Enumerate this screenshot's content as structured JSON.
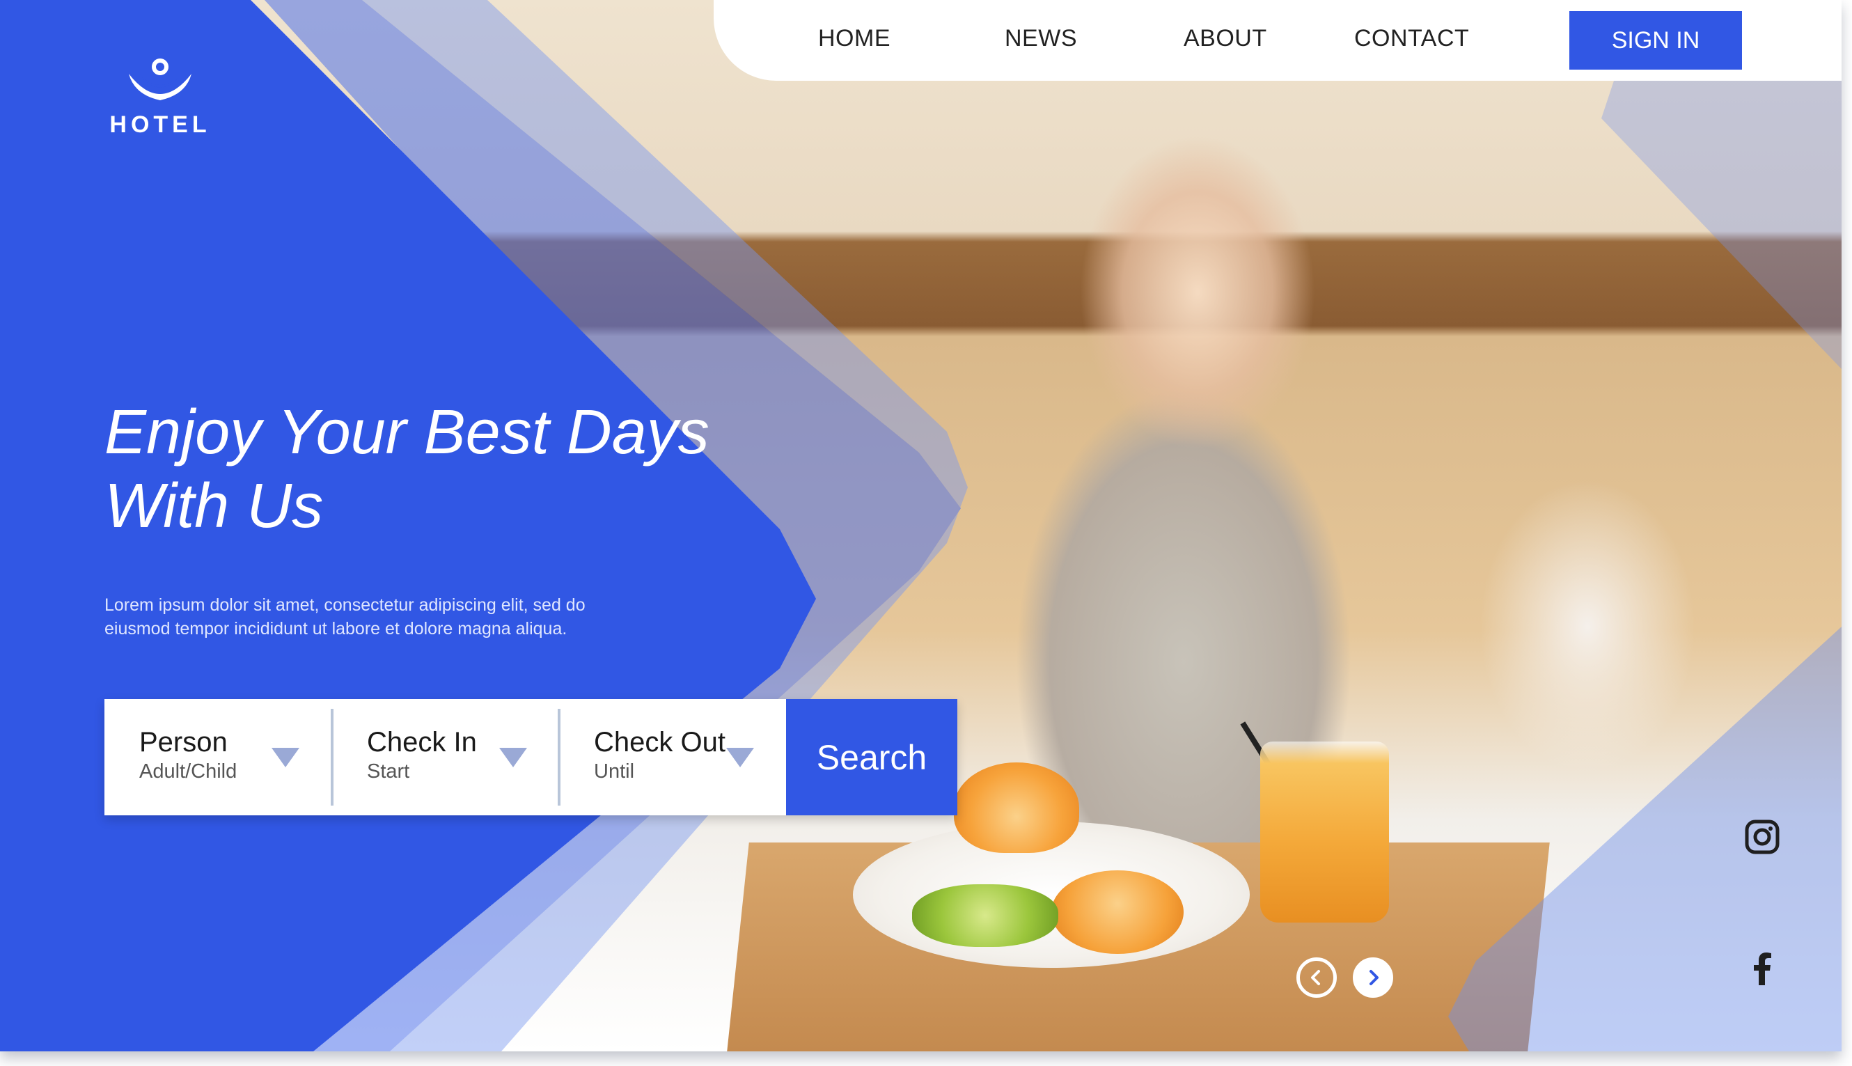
{
  "brand": {
    "name": "HOTEL",
    "color_primary": "#3157e4"
  },
  "nav": {
    "links": [
      "HOME",
      "NEWS",
      "ABOUT",
      "CONTACT"
    ],
    "sign_in": "SIGN IN"
  },
  "hero": {
    "headline_line1": "Enjoy Your Best Days",
    "headline_line2": "With Us",
    "description_line1": "Lorem ipsum dolor sit amet, consectetur adipiscing elit, sed do",
    "description_line2": "eiusmod tempor incididunt ut labore et dolore magna aliqua."
  },
  "booking": {
    "fields": [
      {
        "label": "Person",
        "sub": "Adult/Child",
        "icon": "chevron-down-icon"
      },
      {
        "label": "Check In",
        "sub": "Start",
        "icon": "chevron-down-icon"
      },
      {
        "label": "Check Out",
        "sub": "Until",
        "icon": "chevron-down-icon"
      }
    ],
    "search_label": "Search"
  },
  "carousel": {
    "prev_icon": "arrow-left-icon",
    "next_icon": "arrow-right-icon"
  },
  "social": {
    "icons": [
      "instagram-icon",
      "facebook-icon"
    ]
  }
}
